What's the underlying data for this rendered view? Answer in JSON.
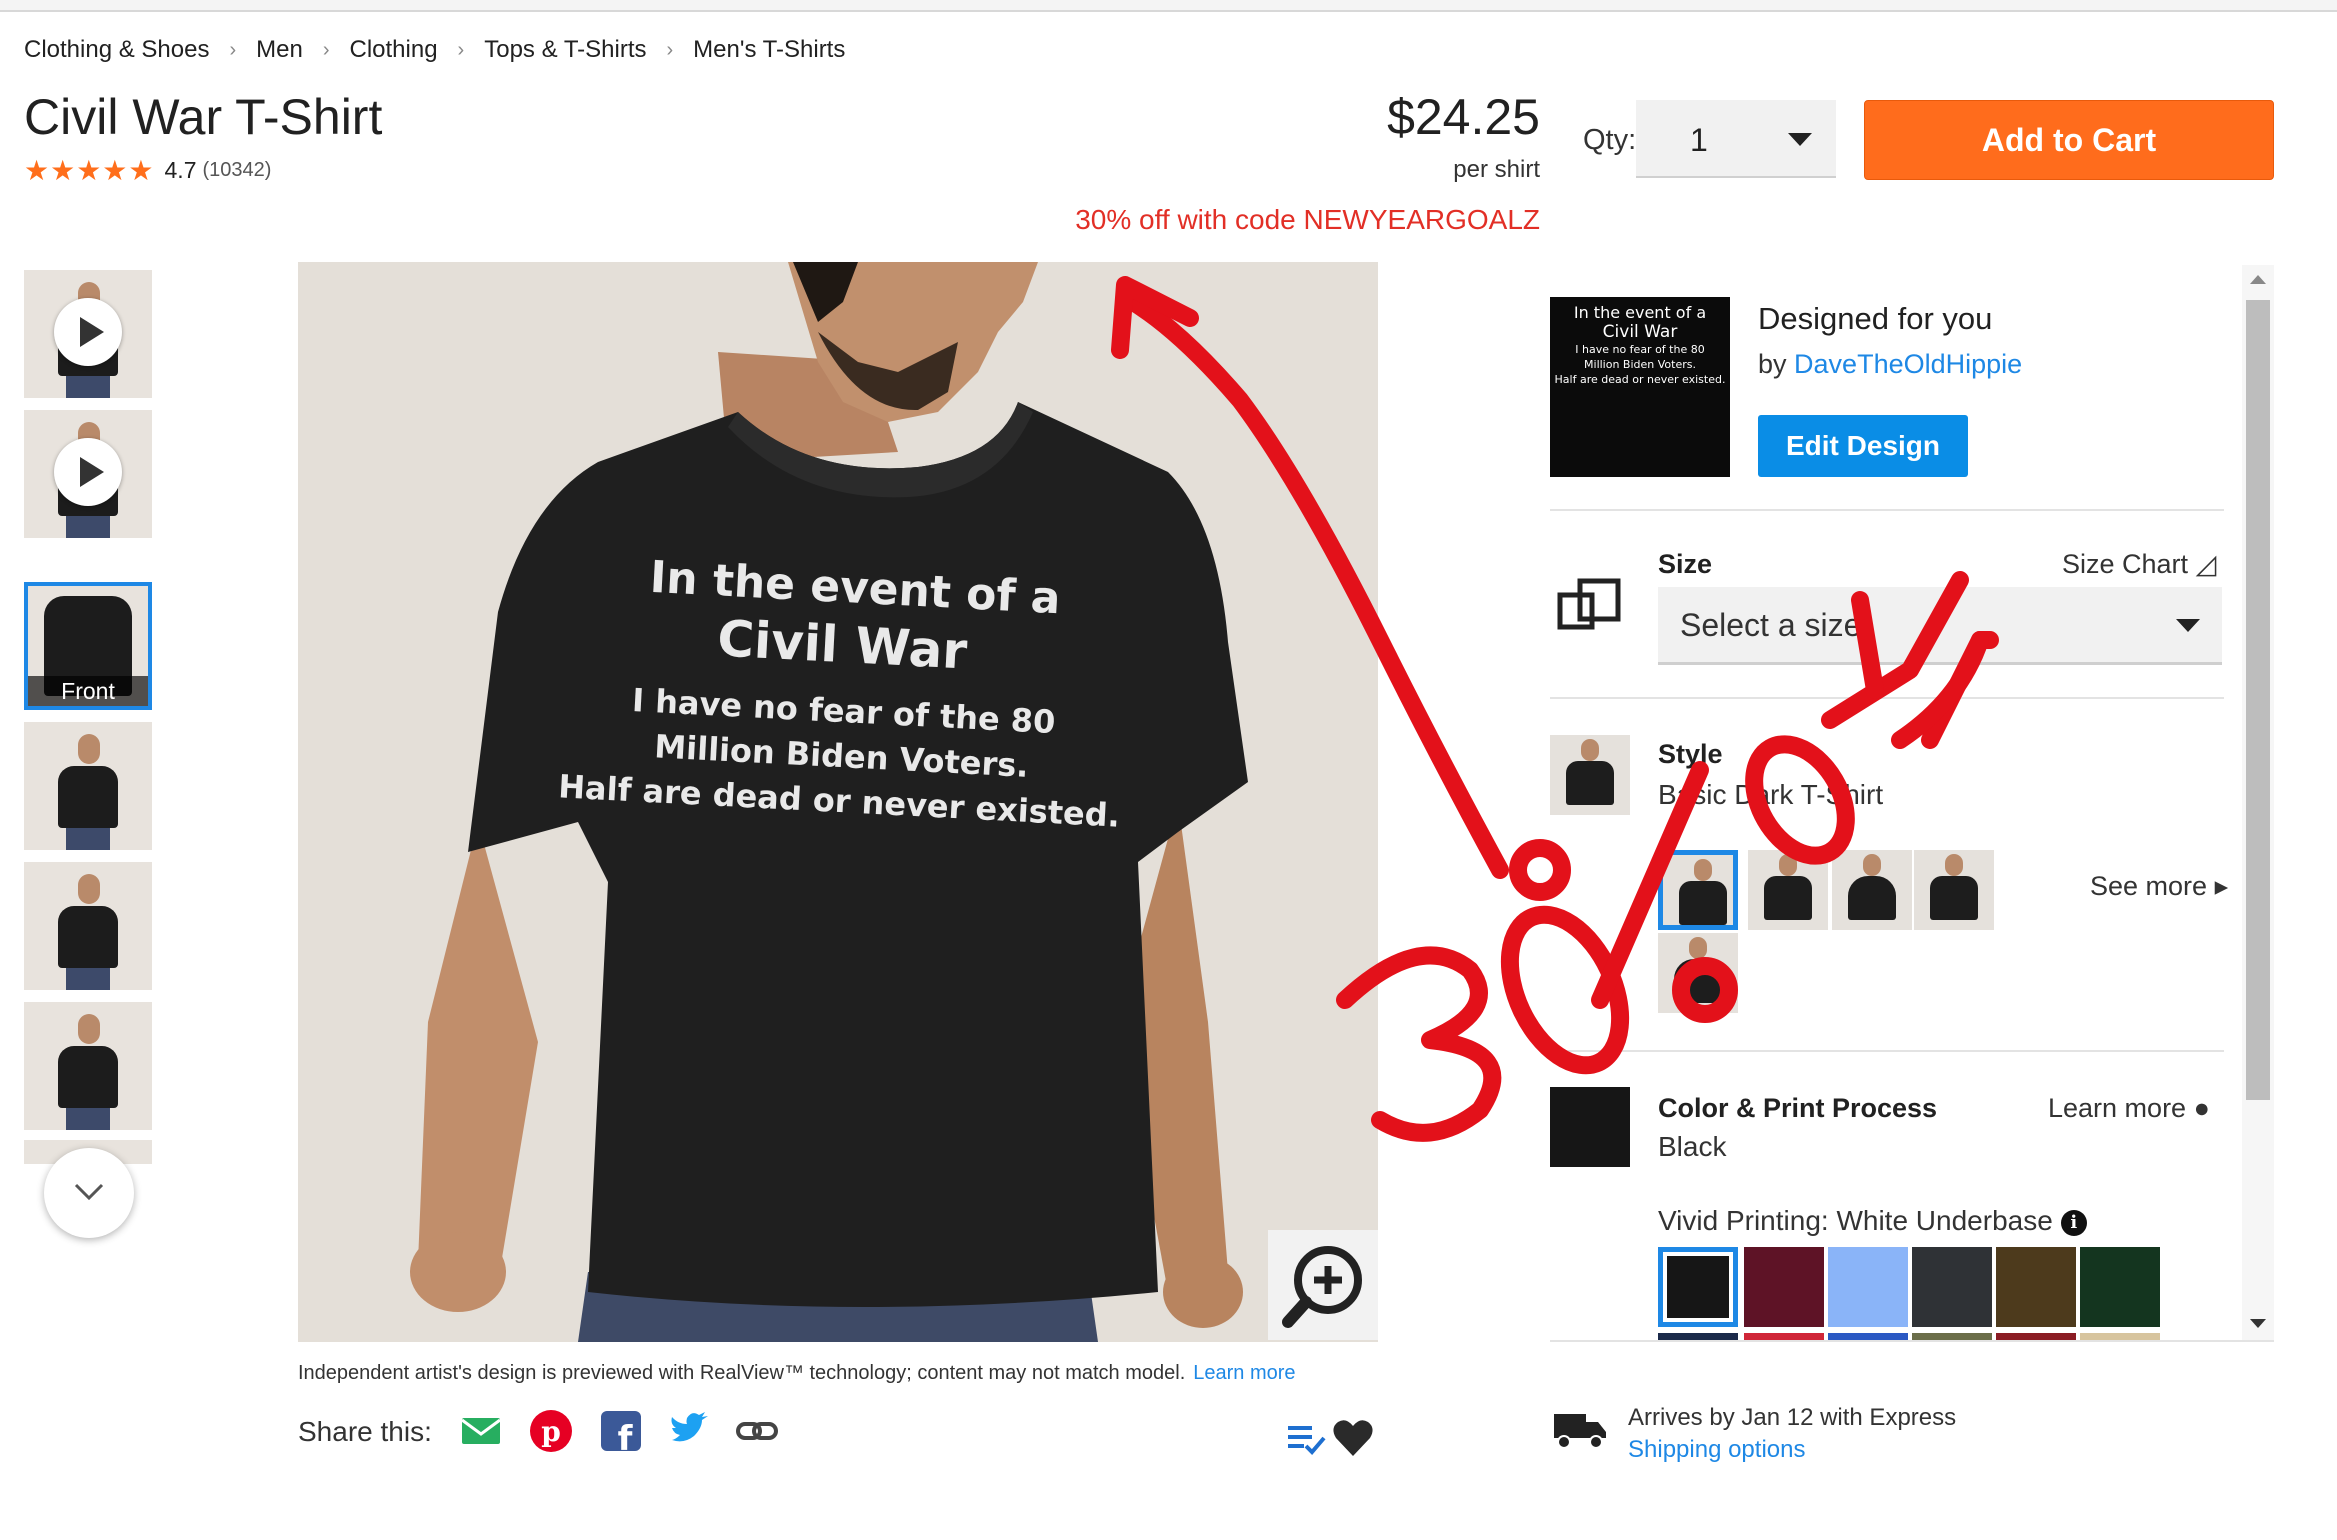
{
  "breadcrumb": [
    "Clothing & Shoes",
    "Men",
    "Clothing",
    "Tops & T-Shirts",
    "Men's T-Shirts"
  ],
  "product": {
    "title": "Civil War T-Shirt",
    "stars": "★★★★★",
    "rating": "4.7",
    "rating_count": "(10342)",
    "price": "$24.25",
    "price_unit": "per shirt",
    "promo": "30% off with code NEWYEARGOALZ"
  },
  "purchase": {
    "qty_label": "Qty:",
    "qty_value": "1",
    "add_to_cart": "Add to Cart"
  },
  "thumbnails": {
    "front_label": "Front"
  },
  "shirt_print": {
    "line1": "In the event of a",
    "line2": "Civil War",
    "line3": "I have no fear of the 80",
    "line4": "Million Biden Voters.",
    "line5": "Half are dead or never existed."
  },
  "disclaimer": {
    "text": "Independent artist's design is previewed with RealView™ technology; content may not match model.",
    "link": "Learn more"
  },
  "share": {
    "label": "Share this:"
  },
  "designer": {
    "heading": "Designed for you",
    "by": "by",
    "name": "DaveTheOldHippie",
    "edit_button": "Edit Design"
  },
  "size": {
    "label": "Size",
    "chart_link": "Size Chart",
    "placeholder": "Select a size"
  },
  "style": {
    "label": "Style",
    "value": "Basic Dark T-Shirt",
    "see_more": "See more"
  },
  "color": {
    "label": "Color & Print Process",
    "value": "Black",
    "learn_more": "Learn more",
    "print_process": "Vivid Printing: White Underbase",
    "swatches": [
      "#161616",
      "#5e1326",
      "#8ab4f8",
      "#2f3236",
      "#4d3a1c",
      "#14351f"
    ]
  },
  "delivery": {
    "arrives": "Arrives by Jan 12 with Express",
    "shipping_link": "Shipping options"
  },
  "annotation": {
    "text": "30% OFF",
    "color": "#e3111a"
  },
  "colors": {
    "accent_orange": "#ff6c1c",
    "link_blue": "#1e88e5",
    "promo_red": "#e22f26",
    "star_orange": "#ff6e1b"
  }
}
